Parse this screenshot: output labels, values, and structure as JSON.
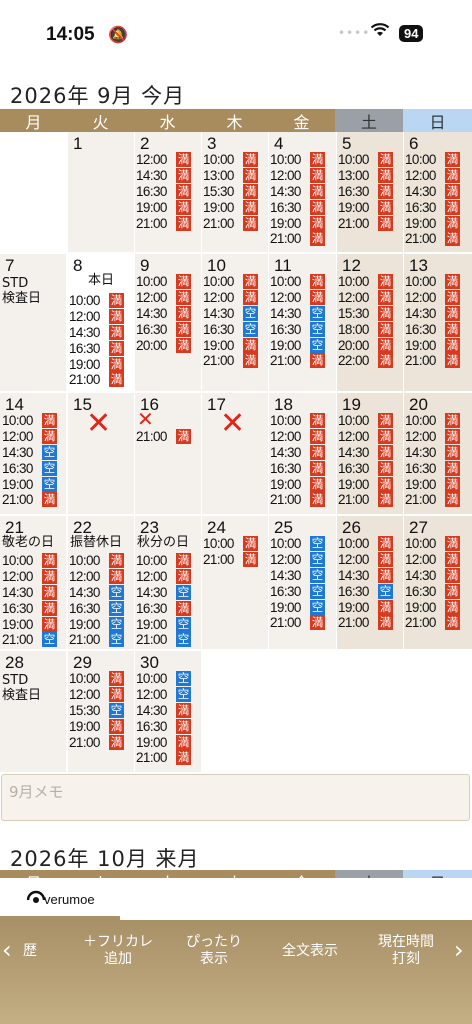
{
  "status": {
    "time": "14:05",
    "bell_icon": "bell-slash-icon",
    "signal_dots": "••••",
    "battery": "94"
  },
  "months": [
    {
      "title": "2026年 9月 今月"
    },
    {
      "title": "2026年 10月 来月"
    }
  ],
  "weekdays": [
    "月",
    "火",
    "水",
    "木",
    "金",
    "土",
    "日"
  ],
  "legend": {
    "full": "満",
    "avail": "空"
  },
  "colors": {
    "full": "#d63a1f",
    "avail": "#1f78d1",
    "header": "#a88c5e",
    "sat": "#9aa0a6",
    "sun": "#b9d7f2"
  },
  "calendar": [
    {
      "day": "1",
      "slots": []
    },
    {
      "day": "2",
      "slots": [
        [
          "12:00",
          "full"
        ],
        [
          "14:30",
          "full"
        ],
        [
          "16:30",
          "full"
        ],
        [
          "19:00",
          "full"
        ],
        [
          "21:00",
          "full"
        ]
      ]
    },
    {
      "day": "3",
      "slots": [
        [
          "10:00",
          "full"
        ],
        [
          "13:00",
          "full"
        ],
        [
          "15:30",
          "full"
        ],
        [
          "19:00",
          "full"
        ],
        [
          "21:00",
          "full"
        ]
      ]
    },
    {
      "day": "4",
      "slots": [
        [
          "10:00",
          "full"
        ],
        [
          "12:00",
          "full"
        ],
        [
          "14:30",
          "full"
        ],
        [
          "16:30",
          "full"
        ],
        [
          "19:00",
          "full"
        ],
        [
          "21:00",
          "full"
        ]
      ]
    },
    {
      "day": "5",
      "slots": [
        [
          "10:00",
          "full"
        ],
        [
          "13:00",
          "full"
        ],
        [
          "16:30",
          "full"
        ],
        [
          "19:00",
          "full"
        ],
        [
          "21:00",
          "full"
        ]
      ]
    },
    {
      "day": "6",
      "slots": [
        [
          "10:00",
          "full"
        ],
        [
          "12:00",
          "full"
        ],
        [
          "14:30",
          "full"
        ],
        [
          "16:30",
          "full"
        ],
        [
          "19:00",
          "full"
        ],
        [
          "21:00",
          "full"
        ]
      ]
    },
    {
      "day": "7",
      "note": "STD\n検査日",
      "slots": []
    },
    {
      "day": "8",
      "note": "本日",
      "today": true,
      "slots": [
        [
          "10:00",
          "full"
        ],
        [
          "12:00",
          "full"
        ],
        [
          "14:30",
          "full"
        ],
        [
          "16:30",
          "full"
        ],
        [
          "19:00",
          "full"
        ],
        [
          "21:00",
          "full"
        ]
      ]
    },
    {
      "day": "9",
      "slots": [
        [
          "10:00",
          "full"
        ],
        [
          "12:00",
          "full"
        ],
        [
          "14:30",
          "full"
        ],
        [
          "16:30",
          "full"
        ],
        [
          "20:00",
          "full"
        ]
      ]
    },
    {
      "day": "10",
      "slots": [
        [
          "10:00",
          "full"
        ],
        [
          "12:00",
          "full"
        ],
        [
          "14:30",
          "avail"
        ],
        [
          "16:30",
          "avail"
        ],
        [
          "19:00",
          "full"
        ],
        [
          "21:00",
          "full"
        ]
      ]
    },
    {
      "day": "11",
      "slots": [
        [
          "10:00",
          "full"
        ],
        [
          "12:00",
          "full"
        ],
        [
          "14:30",
          "avail"
        ],
        [
          "16:30",
          "avail"
        ],
        [
          "19:00",
          "avail"
        ],
        [
          "21:00",
          "full"
        ]
      ]
    },
    {
      "day": "12",
      "slots": [
        [
          "10:00",
          "full"
        ],
        [
          "12:00",
          "full"
        ],
        [
          "15:30",
          "full"
        ],
        [
          "18:00",
          "full"
        ],
        [
          "20:00",
          "full"
        ],
        [
          "22:00",
          "full"
        ]
      ]
    },
    {
      "day": "13",
      "slots": [
        [
          "10:00",
          "full"
        ],
        [
          "12:00",
          "full"
        ],
        [
          "14:30",
          "full"
        ],
        [
          "16:30",
          "full"
        ],
        [
          "19:00",
          "full"
        ],
        [
          "21:00",
          "full"
        ]
      ]
    },
    {
      "day": "14",
      "slots": [
        [
          "10:00",
          "full"
        ],
        [
          "12:00",
          "full"
        ],
        [
          "14:30",
          "avail"
        ],
        [
          "16:30",
          "avail"
        ],
        [
          "19:00",
          "avail"
        ],
        [
          "21:00",
          "full"
        ]
      ]
    },
    {
      "day": "15",
      "closed": true,
      "slots": []
    },
    {
      "day": "16",
      "closed_small": true,
      "slots": [
        [
          "21:00",
          "full"
        ]
      ]
    },
    {
      "day": "17",
      "closed": true,
      "slots": []
    },
    {
      "day": "18",
      "slots": [
        [
          "10:00",
          "full"
        ],
        [
          "12:00",
          "full"
        ],
        [
          "14:30",
          "full"
        ],
        [
          "16:30",
          "full"
        ],
        [
          "19:00",
          "full"
        ],
        [
          "21:00",
          "full"
        ]
      ]
    },
    {
      "day": "19",
      "slots": [
        [
          "10:00",
          "full"
        ],
        [
          "12:00",
          "full"
        ],
        [
          "14:30",
          "full"
        ],
        [
          "16:30",
          "full"
        ],
        [
          "19:00",
          "full"
        ],
        [
          "21:00",
          "full"
        ]
      ]
    },
    {
      "day": "20",
      "slots": [
        [
          "10:00",
          "full"
        ],
        [
          "12:00",
          "full"
        ],
        [
          "14:30",
          "full"
        ],
        [
          "16:30",
          "full"
        ],
        [
          "19:00",
          "full"
        ],
        [
          "21:00",
          "full"
        ]
      ]
    },
    {
      "day": "21",
      "note": "敬老の日",
      "slots": [
        [
          "10:00",
          "full"
        ],
        [
          "12:00",
          "full"
        ],
        [
          "14:30",
          "full"
        ],
        [
          "16:30",
          "full"
        ],
        [
          "19:00",
          "full"
        ],
        [
          "21:00",
          "avail"
        ]
      ]
    },
    {
      "day": "22",
      "note": "振替休日",
      "slots": [
        [
          "10:00",
          "full"
        ],
        [
          "12:00",
          "full"
        ],
        [
          "14:30",
          "avail"
        ],
        [
          "16:30",
          "avail"
        ],
        [
          "19:00",
          "avail"
        ],
        [
          "21:00",
          "avail"
        ]
      ]
    },
    {
      "day": "23",
      "note": "秋分の日",
      "slots": [
        [
          "10:00",
          "full"
        ],
        [
          "12:00",
          "full"
        ],
        [
          "14:30",
          "avail"
        ],
        [
          "16:30",
          "full"
        ],
        [
          "19:00",
          "avail"
        ],
        [
          "21:00",
          "avail"
        ]
      ]
    },
    {
      "day": "24",
      "slots": [
        [
          "10:00",
          "full"
        ],
        [
          "21:00",
          "full"
        ]
      ]
    },
    {
      "day": "25",
      "slots": [
        [
          "10:00",
          "avail"
        ],
        [
          "12:00",
          "avail"
        ],
        [
          "14:30",
          "avail"
        ],
        [
          "16:30",
          "avail"
        ],
        [
          "19:00",
          "avail"
        ],
        [
          "21:00",
          "full"
        ]
      ]
    },
    {
      "day": "26",
      "slots": [
        [
          "10:00",
          "full"
        ],
        [
          "12:00",
          "full"
        ],
        [
          "14:30",
          "full"
        ],
        [
          "16:30",
          "avail"
        ],
        [
          "19:00",
          "full"
        ],
        [
          "21:00",
          "full"
        ]
      ]
    },
    {
      "day": "27",
      "slots": [
        [
          "10:00",
          "full"
        ],
        [
          "12:00",
          "full"
        ],
        [
          "14:30",
          "full"
        ],
        [
          "16:30",
          "full"
        ],
        [
          "19:00",
          "full"
        ],
        [
          "21:00",
          "full"
        ]
      ]
    },
    {
      "day": "28",
      "note": "STD\n検査日",
      "slots": []
    },
    {
      "day": "29",
      "slots": [
        [
          "10:00",
          "full"
        ],
        [
          "12:00",
          "full"
        ],
        [
          "15:30",
          "avail"
        ],
        [
          "19:00",
          "full"
        ],
        [
          "21:00",
          "full"
        ]
      ]
    },
    {
      "day": "30",
      "slots": [
        [
          "10:00",
          "avail"
        ],
        [
          "12:00",
          "avail"
        ],
        [
          "14:30",
          "full"
        ],
        [
          "16:30",
          "full"
        ],
        [
          "19:00",
          "full"
        ],
        [
          "21:00",
          "full"
        ]
      ]
    }
  ],
  "memo": {
    "label": "9月メモ"
  },
  "logo": {
    "text": "verumoe",
    "icon": "eye-icon"
  },
  "toolbar": {
    "prev_icon": "‹",
    "next_icon": "›",
    "history": "歴",
    "add_calendar": "＋フリカレ\n追加",
    "fit_view": "ぴったり\n表示",
    "full_text": "全文表示",
    "punch_time": "現在時間\n打刻"
  }
}
